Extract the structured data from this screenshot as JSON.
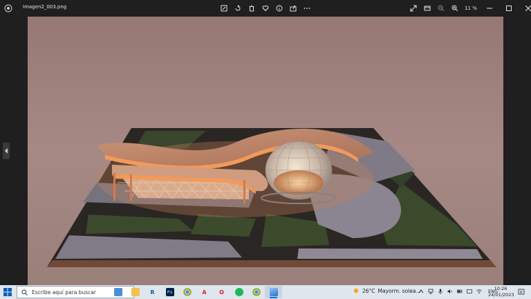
{
  "window": {
    "filename": "Imagen2_003.png",
    "zoom": "11 %",
    "toolbar_icons": [
      "edit-image-icon",
      "rotate-icon",
      "delete-icon",
      "favorite-icon",
      "info-icon",
      "share-icon",
      "more-icon"
    ],
    "right_icons": [
      "fullscreen-icon",
      "slideshow-icon",
      "zoom-out-icon",
      "zoom-in-icon"
    ],
    "window_controls": [
      "minimize-icon",
      "maximize-icon",
      "close-icon"
    ]
  },
  "taskbar": {
    "search_placeholder": "Escribe aquí para buscar",
    "apps": [
      {
        "name": "explorer",
        "label": "",
        "color": "#f2c14e"
      },
      {
        "name": "revit",
        "label": "R",
        "color": "#1c5aa6"
      },
      {
        "name": "photoshop",
        "label": "Ps",
        "color": "#0b1f3a"
      },
      {
        "name": "chrome",
        "label": "",
        "color": "#e34133"
      },
      {
        "name": "acrobat",
        "label": "A",
        "color": "#d7282f"
      },
      {
        "name": "opera",
        "label": "O",
        "color": "#d41c2a"
      },
      {
        "name": "spotify",
        "label": "",
        "color": "#1db954"
      },
      {
        "name": "chrome-2",
        "label": "",
        "color": "#e34133"
      },
      {
        "name": "photos",
        "label": "",
        "color": "#2a6fc9"
      }
    ],
    "weather": {
      "temp": "26°C",
      "desc": "Mayorm. solea..."
    },
    "lang": "ENG",
    "time": "10:26",
    "date": "24/01/2023"
  },
  "colors": {
    "background": "#1f1f1f",
    "taskbar": "#dfe6ee",
    "accent": "#0078d4",
    "sky": "#9d7d78"
  }
}
